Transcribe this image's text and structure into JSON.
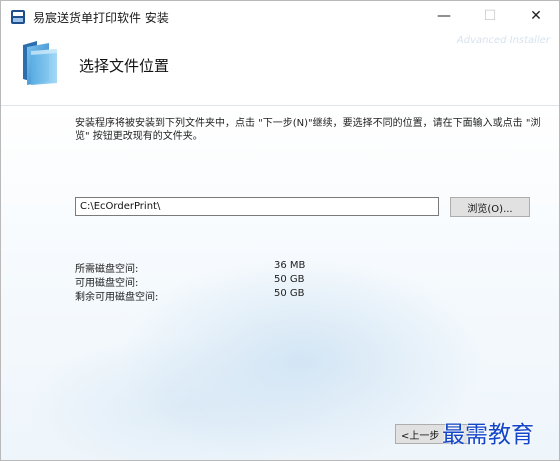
{
  "window": {
    "title": "易宸送货单打印软件 安装",
    "controls": {
      "minimize": "—",
      "maximize": "☐",
      "close": "✕"
    }
  },
  "header": {
    "brand": "Advanced Installer",
    "page_title": "选择文件位置",
    "icon": "folder-icon"
  },
  "main": {
    "description": "安装程序将被安装到下列文件夹中，点击 \"下一步(N)\"继续，要选择不同的位置，请在下面输入或点击 \"浏览\" 按钮更改现有的文件夹。",
    "install_path": "C:\\EcOrderPrint\\",
    "browse_label": "浏览(O)...",
    "disk_space": [
      {
        "label": "所需磁盘空间:",
        "value": "36 MB"
      },
      {
        "label": "可用磁盘空间:",
        "value": "50 GB"
      },
      {
        "label": "剩余可用磁盘空间:",
        "value": "50 GB"
      }
    ]
  },
  "footer": {
    "back_label": "<上一步"
  },
  "watermark": "最需教育"
}
